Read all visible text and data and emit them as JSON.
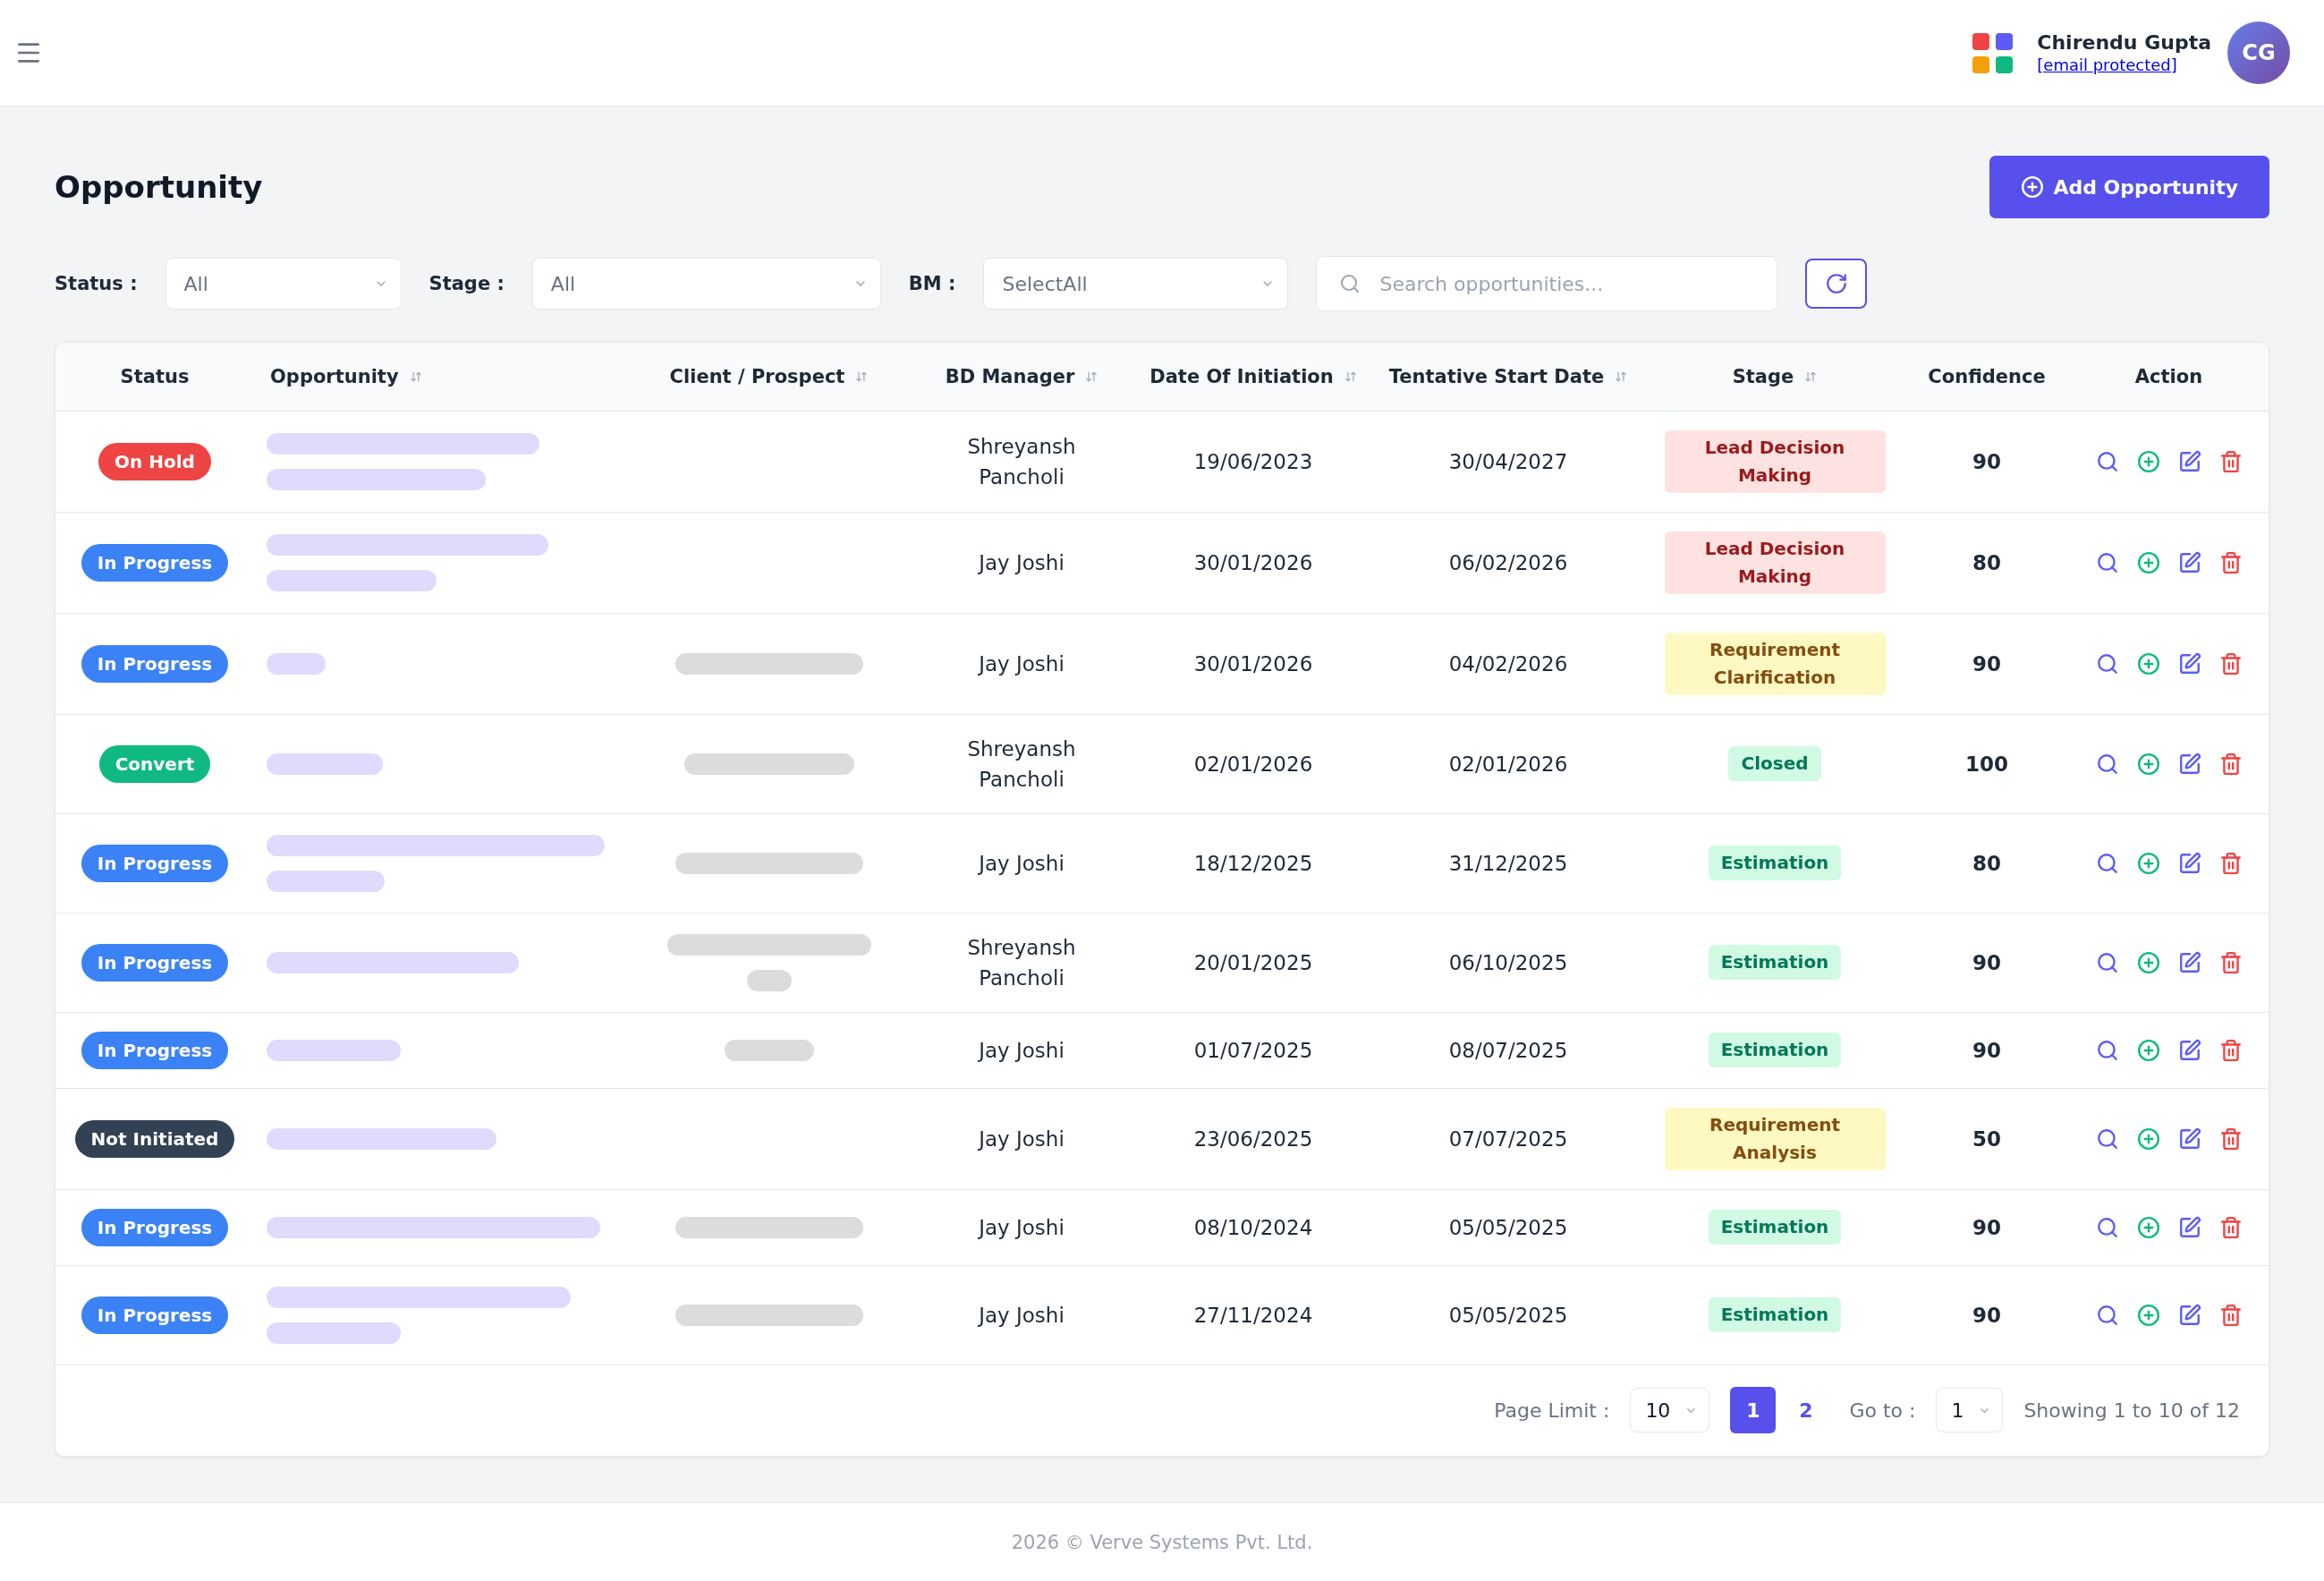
{
  "header": {
    "user": {
      "name": "Chirendu Gupta",
      "email": "[email protected]",
      "initials": "CG"
    }
  },
  "page": {
    "title": "Opportunity",
    "add_button": "Add Opportunity"
  },
  "filters": [
    {
      "label": "Status :",
      "value": "All"
    },
    {
      "label": "Stage :",
      "value": "All"
    },
    {
      "label": "BM :",
      "value": "SelectAll"
    }
  ],
  "search": {
    "placeholder": "Search opportunities..."
  },
  "table": {
    "columns": [
      {
        "label": "Status",
        "sortable": false
      },
      {
        "label": "Opportunity",
        "sortable": true
      },
      {
        "label": "Client / Prospect",
        "sortable": true
      },
      {
        "label": "BD Manager",
        "sortable": true
      },
      {
        "label": "Date Of Initiation",
        "sortable": true
      },
      {
        "label": "Tentative Start Date",
        "sortable": true
      },
      {
        "label": "Stage",
        "sortable": true
      },
      {
        "label": "Confidence",
        "sortable": false
      },
      {
        "label": "Action",
        "sortable": false
      }
    ],
    "rows": [
      {
        "status": {
          "label": "On Hold",
          "color": "#ef4444"
        },
        "opportunity_blurred": true,
        "client_blurred": false,
        "bd_manager": "Shreyansh Pancholi",
        "date_of_initiation": "19/06/2023",
        "tentative_start_date": "30/04/2027",
        "stage": {
          "label": "Lead Decision Making",
          "color": "#fee2e2"
        },
        "confidence": "90"
      },
      {
        "status": {
          "label": "In Progress",
          "color": "#3b82f6"
        },
        "opportunity_blurred": true,
        "client_blurred": false,
        "bd_manager": "Jay Joshi",
        "date_of_initiation": "30/01/2026",
        "tentative_start_date": "06/02/2026",
        "stage": {
          "label": "Lead Decision Making",
          "color": "#fee2e2"
        },
        "confidence": "80"
      },
      {
        "status": {
          "label": "In Progress",
          "color": "#3b82f6"
        },
        "opportunity_blurred": true,
        "client_blurred": true,
        "bd_manager": "Jay Joshi",
        "date_of_initiation": "30/01/2026",
        "tentative_start_date": "04/02/2026",
        "stage": {
          "label": "Requirement Clarification",
          "color": "#fef9c3"
        },
        "confidence": "90"
      },
      {
        "status": {
          "label": "Convert",
          "color": "#10b981"
        },
        "opportunity_blurred": true,
        "client_blurred": true,
        "bd_manager": "Shreyansh Pancholi",
        "date_of_initiation": "02/01/2026",
        "tentative_start_date": "02/01/2026",
        "stage": {
          "label": "Closed",
          "color": "#d1fae5"
        },
        "confidence": "100"
      },
      {
        "status": {
          "label": "In Progress",
          "color": "#3b82f6"
        },
        "opportunity_blurred": true,
        "client_blurred": true,
        "bd_manager": "Jay Joshi",
        "date_of_initiation": "18/12/2025",
        "tentative_start_date": "31/12/2025",
        "stage": {
          "label": "Estimation",
          "color": "#d1fae5"
        },
        "confidence": "80"
      },
      {
        "status": {
          "label": "In Progress",
          "color": "#3b82f6"
        },
        "opportunity_blurred": true,
        "client_blurred": true,
        "bd_manager": "Shreyansh Pancholi",
        "date_of_initiation": "20/01/2025",
        "tentative_start_date": "06/10/2025",
        "stage": {
          "label": "Estimation",
          "color": "#d1fae5"
        },
        "confidence": "90"
      },
      {
        "status": {
          "label": "In Progress",
          "color": "#3b82f6"
        },
        "opportunity_blurred": true,
        "client_blurred": true,
        "bd_manager": "Jay Joshi",
        "date_of_initiation": "01/07/2025",
        "tentative_start_date": "08/07/2025",
        "stage": {
          "label": "Estimation",
          "color": "#d1fae5"
        },
        "confidence": "90"
      },
      {
        "status": {
          "label": "Not Initiated",
          "color": "#334155"
        },
        "opportunity_blurred": true,
        "client_blurred": false,
        "bd_manager": "Jay Joshi",
        "date_of_initiation": "23/06/2025",
        "tentative_start_date": "07/07/2025",
        "stage": {
          "label": "Requirement Analysis",
          "color": "#fef9c3"
        },
        "confidence": "50"
      },
      {
        "status": {
          "label": "In Progress",
          "color": "#3b82f6"
        },
        "opportunity_blurred": true,
        "client_blurred": true,
        "bd_manager": "Jay Joshi",
        "date_of_initiation": "08/10/2024",
        "tentative_start_date": "05/05/2025",
        "stage": {
          "label": "Estimation",
          "color": "#d1fae5"
        },
        "confidence": "90"
      },
      {
        "status": {
          "label": "In Progress",
          "color": "#3b82f6"
        },
        "opportunity_blurred": true,
        "client_blurred": true,
        "bd_manager": "Jay Joshi",
        "date_of_initiation": "27/11/2024",
        "tentative_start_date": "05/05/2025",
        "stage": {
          "label": "Estimation",
          "color": "#d1fae5"
        },
        "confidence": "90"
      }
    ]
  },
  "pagination": {
    "page_limit_label": "Page Limit :",
    "page_limit": "10",
    "pages": [
      {
        "label": "1",
        "selected": true
      },
      {
        "label": "2",
        "selected": false
      }
    ],
    "goto_label": "Go to :",
    "goto": "1",
    "summary": "Showing 1 to 10 of 12"
  },
  "footer": {
    "text": "2026 © Verve Systems Pvt. Ltd."
  }
}
